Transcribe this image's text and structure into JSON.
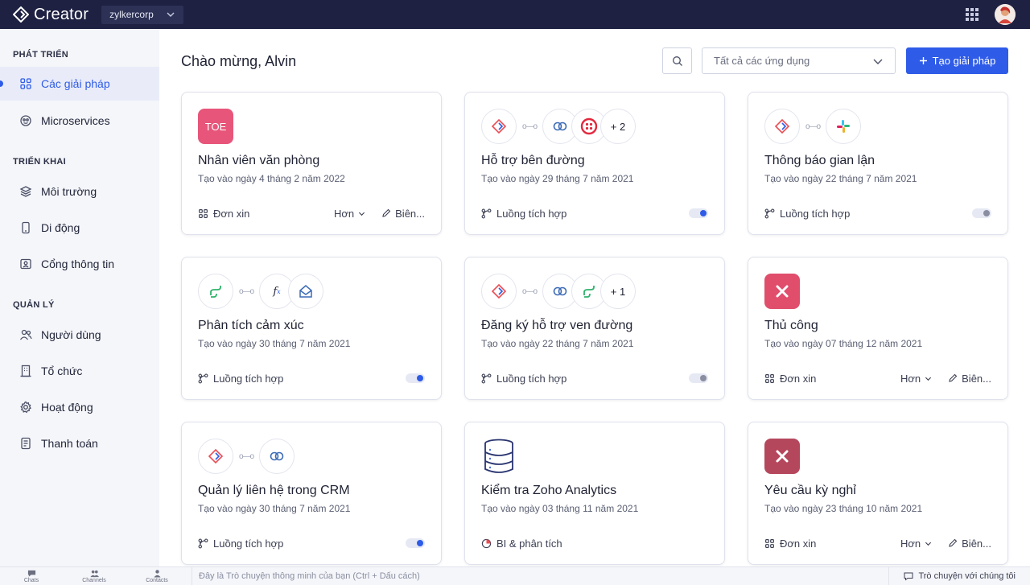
{
  "topbar": {
    "brand": "Creator",
    "org": "zylkercorp"
  },
  "sidebar": {
    "sections": [
      {
        "title": "PHÁT TRIỂN",
        "items": [
          {
            "label": "Các giải pháp",
            "icon": "solutions-icon",
            "active": true
          },
          {
            "label": "Microservices",
            "icon": "microservices-icon"
          }
        ]
      },
      {
        "title": "TRIỂN KHAI",
        "items": [
          {
            "label": "Môi trường",
            "icon": "layers-icon"
          },
          {
            "label": "Di động",
            "icon": "mobile-icon"
          },
          {
            "label": "Cổng thông tin",
            "icon": "portal-icon"
          }
        ]
      },
      {
        "title": "QUẢN LÝ",
        "items": [
          {
            "label": "Người dùng",
            "icon": "users-icon"
          },
          {
            "label": "Tổ chức",
            "icon": "organization-icon"
          },
          {
            "label": "Hoạt động",
            "icon": "gear-icon"
          },
          {
            "label": "Thanh toán",
            "icon": "billing-icon"
          }
        ]
      }
    ]
  },
  "main": {
    "welcome": "Chào mừng, Alvin",
    "filter": "Tất cả các ứng dụng",
    "create": "Tạo giải pháp",
    "cards": [
      {
        "title": "Nhân viên văn phòng",
        "date": "Tạo vào ngày 4 tháng 2 năm 2022",
        "badge": "TOE",
        "type": "Đơn xin",
        "more": "Hơn",
        "edit": "Biên..."
      },
      {
        "title": "Hỗ trợ bên đường",
        "date": "Tạo vào ngày 29 tháng 7 năm 2021",
        "extra": "+ 2",
        "type": "Luồng tích hợp",
        "toggle": true
      },
      {
        "title": "Thông báo gian lận",
        "date": "Tạo vào ngày 22 tháng 7 năm 2021",
        "type": "Luồng tích hợp",
        "toggle": false
      },
      {
        "title": "Phân tích cảm xúc",
        "date": "Tạo vào ngày 30 tháng 7 năm 2021",
        "type": "Luồng tích hợp",
        "toggle": true
      },
      {
        "title": "Đăng ký hỗ trợ ven đường",
        "date": "Tạo vào ngày 22 tháng 7 năm 2021",
        "extra": "+ 1",
        "type": "Luồng tích hợp",
        "toggle": false
      },
      {
        "title": "Thủ công",
        "date": "Tạo vào ngày 07 tháng 12 năm 2021",
        "type": "Đơn xin",
        "more": "Hơn",
        "edit": "Biên..."
      },
      {
        "title": "Quản lý liên hệ trong CRM",
        "date": "Tạo vào ngày 30 tháng 7 năm 2021",
        "type": "Luồng tích hợp",
        "toggle": true
      },
      {
        "title": "Kiểm tra Zoho Analytics",
        "date": "Tạo vào ngày 03 tháng 11 năm 2021",
        "type": "BI & phân tích"
      },
      {
        "title": "Yêu cầu kỳ nghỉ",
        "date": "Tạo vào ngày 23 tháng 10 năm 2021",
        "type": "Đơn xin",
        "more": "Hơn",
        "edit": "Biên..."
      }
    ]
  },
  "bottombar": {
    "chats": "Chats",
    "channels": "Channels",
    "contacts": "Contacts",
    "chat_placeholder": "Đây là Trò chuyện thông minh của bạn (Ctrl + Dấu cách)",
    "chat_with_us": "Trò chuyện với chúng tôi"
  },
  "colors": {
    "topbar": "#1e2142",
    "accent": "#2e5be8",
    "toe_badge": "#e8557a",
    "manual_badge": "#e04e6c",
    "leave_badge": "#b5475d"
  }
}
